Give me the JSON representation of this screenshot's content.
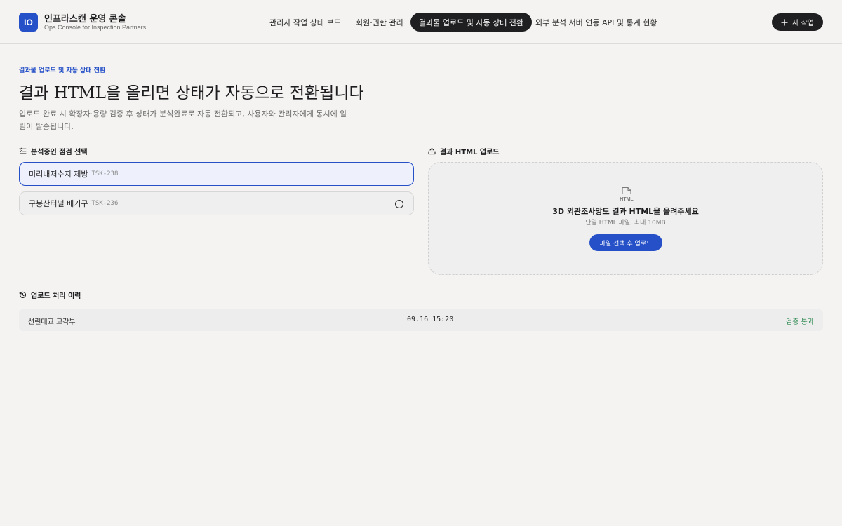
{
  "app": {
    "logo_text": "IO",
    "title": "인프라스캔 운영 콘솔",
    "subtitle": "Ops Console for Inspection Partners"
  },
  "nav": {
    "items": [
      {
        "label": "관리자 작업 상태 보드",
        "active": false
      },
      {
        "label": "회원·권한 관리",
        "active": false
      },
      {
        "label": "결과물 업로드 및 자동 상태 전환",
        "active": true
      },
      {
        "label": "외부 분석 서버 연동 API 및 통계 현황",
        "active": false
      }
    ],
    "new_task_label": "새 작업"
  },
  "page": {
    "eyebrow": "결과물 업로드 및 자동 상태 전환",
    "headline": "결과 HTML을 올리면 상태가 자동으로 전환됩니다",
    "description": "업로드 완료 시 확장자·용량 검증 후 상태가 분석완료로 자동 전환되고, 사용자와 관리자에게 동시에 알림이 발송됩니다."
  },
  "task_select": {
    "label": "분석중인 점검 선택",
    "tasks": [
      {
        "name": "미리내저수지 제방",
        "code": "TSK-238",
        "selected": true
      },
      {
        "name": "구봉산터널 배기구",
        "code": "TSK-236",
        "selected": false
      }
    ]
  },
  "upload": {
    "label": "결과 HTML 업로드",
    "file_icon_text": "HTML",
    "title": "3D 외관조사망도 결과 HTML을 올려주세요",
    "subtitle": "단일 HTML 파일, 최대 10MB",
    "button_label": "파일 선택 후 업로드"
  },
  "history": {
    "label": "업로드 처리 이력",
    "rows": [
      {
        "name": "선린대교 교각부",
        "time": "09.16 15:20",
        "status": "검증 통과"
      }
    ]
  },
  "colors": {
    "accent": "#2550c8",
    "dark": "#1f1f21",
    "success": "#2f8a52",
    "background": "#f4f3f1"
  }
}
